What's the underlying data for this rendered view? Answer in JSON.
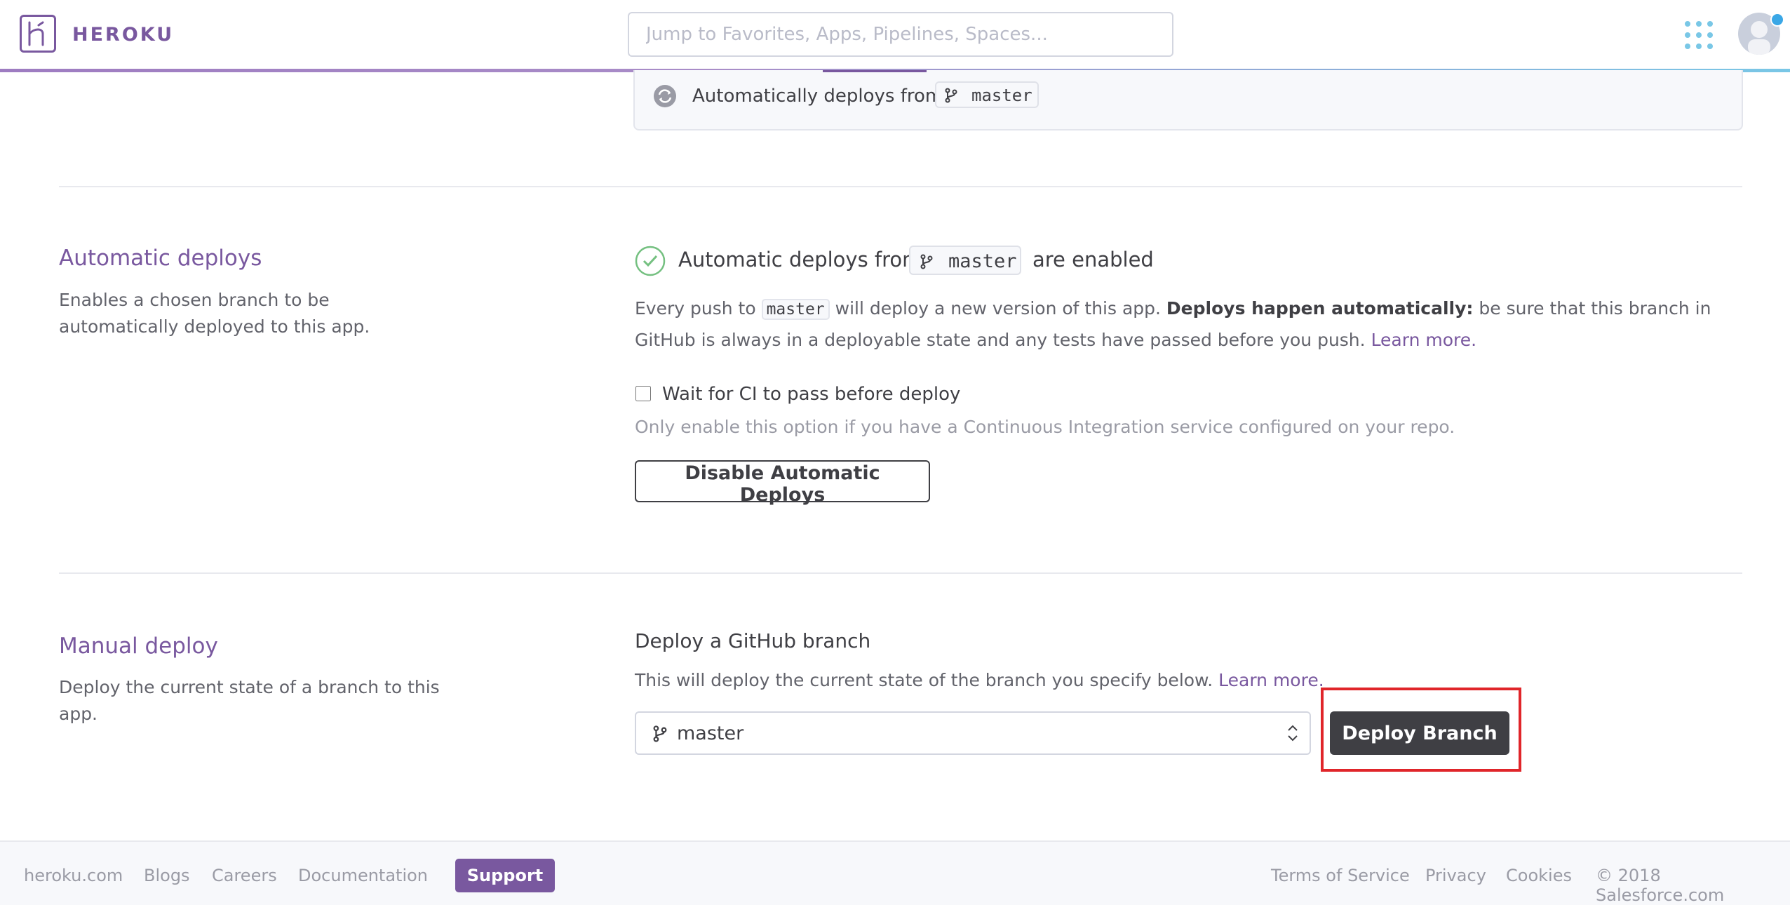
{
  "header": {
    "brand": "HEROKU",
    "search_placeholder": "Jump to Favorites, Apps, Pipelines, Spaces..."
  },
  "top_card": {
    "text": "Automatically deploys from",
    "branch": "master"
  },
  "automatic_deploys": {
    "title": "Automatic deploys",
    "description": "Enables a chosen branch to be automatically deployed to this app.",
    "status_prefix": "Automatic deploys from",
    "branch": "master",
    "status_suffix": "are enabled",
    "para_prefix": "Every push to",
    "para_code": "master",
    "para_mid": "will deploy a new version of this app.",
    "para_bold": "Deploys happen automatically:",
    "para_rest": "be sure that this branch in GitHub is always in a deployable state and any tests have passed before you push.",
    "learn_more": "Learn more.",
    "ci_checkbox_label": "Wait for CI to pass before deploy",
    "ci_hint": "Only enable this option if you have a Continuous Integration service configured on your repo.",
    "disable_button": "Disable Automatic Deploys"
  },
  "manual_deploy": {
    "title": "Manual deploy",
    "description": "Deploy the current state of a branch to this app.",
    "heading": "Deploy a GitHub branch",
    "desc_text": "This will deploy the current state of the branch you specify below.",
    "learn_more": "Learn more.",
    "branch_selected": "master",
    "deploy_button": "Deploy Branch"
  },
  "footer": {
    "links": [
      "heroku.com",
      "Blogs",
      "Careers",
      "Documentation"
    ],
    "support": "Support",
    "right_links": [
      "Terms of Service",
      "Privacy",
      "Cookies"
    ],
    "copyright": "© 2018 Salesforce.com"
  },
  "colors": {
    "brand_purple": "#79589f",
    "accent_blue": "#79c7e6",
    "success_green": "#74c080",
    "highlight_red": "#e0252a"
  }
}
